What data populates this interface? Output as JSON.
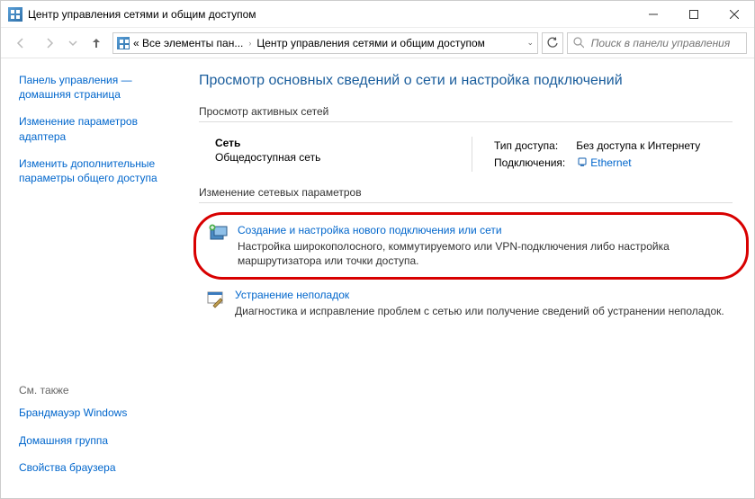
{
  "window": {
    "title": "Центр управления сетями и общим доступом"
  },
  "breadcrumb": {
    "items": [
      "« Все элементы пан...",
      "Центр управления сетями и общим доступом"
    ]
  },
  "search": {
    "placeholder": "Поиск в панели управления"
  },
  "sidebar": {
    "links": [
      "Панель управления — домашняя страница",
      "Изменение параметров адаптера",
      "Изменить дополнительные параметры общего доступа"
    ],
    "see_also_label": "См. также",
    "see_also": [
      "Брандмауэр Windows",
      "Домашняя группа",
      "Свойства браузера"
    ]
  },
  "main": {
    "heading": "Просмотр основных сведений о сети и настройка подключений",
    "active_networks_label": "Просмотр активных сетей",
    "network": {
      "name": "Сеть",
      "type": "Общедоступная сеть",
      "access_label": "Тип доступа:",
      "access_value": "Без доступа к Интернету",
      "conn_label": "Подключения:",
      "conn_value": "Ethernet"
    },
    "change_settings_label": "Изменение сетевых параметров",
    "options": [
      {
        "title": "Создание и настройка нового подключения или сети",
        "desc": "Настройка широкополосного, коммутируемого или VPN-подключения либо настройка маршрутизатора или точки доступа."
      },
      {
        "title": "Устранение неполадок",
        "desc": "Диагностика и исправление проблем с сетью или получение сведений об устранении неполадок."
      }
    ]
  }
}
